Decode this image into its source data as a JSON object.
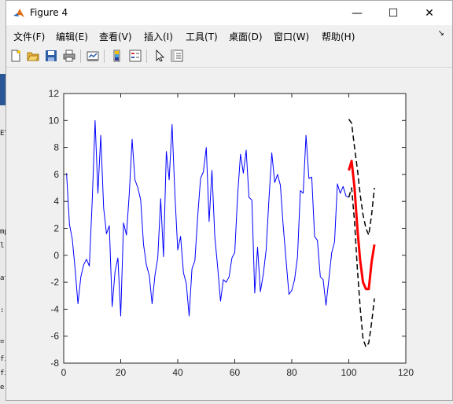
{
  "window": {
    "title": "Figure 4",
    "minimize_symbol": "—",
    "maximize_symbol": "☐",
    "close_symbol": "✕",
    "dock_symbol": "↘"
  },
  "menu": [
    {
      "label": "文件(F)"
    },
    {
      "label": "编辑(E)"
    },
    {
      "label": "查看(V)"
    },
    {
      "label": "插入(I)"
    },
    {
      "label": "工具(T)"
    },
    {
      "label": "桌面(D)"
    },
    {
      "label": "窗口(W)"
    },
    {
      "label": "帮助(H)"
    }
  ],
  "toolbar": {
    "icons": [
      "new-figure-icon",
      "open-file-icon",
      "save-icon",
      "print-icon",
      "link-plot-icon",
      "insert-colorbar-icon",
      "insert-legend-icon",
      "edit-plot-icon",
      "property-inspector-icon"
    ]
  },
  "background": {
    "fragments": [
      "mp",
      "l)",
      "at",
      ":",
      "=",
      "fi",
      "fi",
      "er"
    ],
    "side_fragment": "E\\"
  },
  "chart_data": {
    "type": "line",
    "xlim": [
      0,
      120
    ],
    "ylim": [
      -8,
      12
    ],
    "xticks": [
      0,
      20,
      40,
      60,
      80,
      100,
      120
    ],
    "yticks": [
      -8,
      -6,
      -4,
      -2,
      0,
      2,
      4,
      6,
      8,
      10,
      12
    ],
    "grid": false,
    "series": [
      {
        "style": "solid-blue",
        "color": "#0000ff",
        "x": [
          1,
          2,
          3,
          4,
          5,
          6,
          7,
          8,
          9,
          10,
          11,
          12,
          13,
          14,
          15,
          16,
          17,
          18,
          19,
          20,
          21,
          22,
          23,
          24,
          25,
          26,
          27,
          28,
          29,
          30,
          31,
          32,
          33,
          34,
          35,
          36,
          37,
          38,
          39,
          40,
          41,
          42,
          43,
          44,
          45,
          46,
          47,
          48,
          49,
          50,
          51,
          52,
          53,
          54,
          55,
          56,
          57,
          58,
          59,
          60,
          61,
          62,
          63,
          64,
          65,
          66,
          67,
          68,
          69,
          70,
          71,
          72,
          73,
          74,
          75,
          76,
          77,
          78,
          79,
          80,
          81,
          82,
          83,
          84,
          85,
          86,
          87,
          88,
          89,
          90,
          91,
          92,
          93,
          94,
          95,
          96,
          97,
          98,
          99,
          100
        ],
        "y": [
          6.1,
          2.3,
          1.2,
          -1.0,
          -3.6,
          -1.6,
          -0.7,
          -0.3,
          -0.8,
          4.1,
          10.0,
          4.6,
          8.9,
          3.5,
          1.6,
          2.2,
          -3.8,
          -1.2,
          -0.2,
          -4.5,
          2.4,
          1.5,
          4.6,
          8.6,
          5.6,
          5.0,
          4.1,
          0.8,
          -0.7,
          -1.5,
          -3.6,
          -1.5,
          -0.2,
          4.2,
          -0.1,
          7.7,
          5.6,
          9.7,
          4.5,
          0.4,
          1.4,
          -1.3,
          -2.1,
          -4.5,
          -1.0,
          -0.4,
          2.9,
          5.7,
          6.2,
          8.0,
          2.5,
          6.3,
          1.4,
          -0.9,
          -3.4,
          -1.8,
          -2.0,
          -1.6,
          -0.2,
          0.2,
          4.4,
          7.5,
          6.1,
          7.8,
          4.3,
          4.1,
          -2.8,
          0.6,
          -2.7,
          -1.4,
          0.4,
          4.2,
          7.6,
          5.4,
          6.0,
          5.2,
          2.2,
          -0.4,
          -2.9,
          -2.6,
          -1.8,
          -0.1,
          4.8,
          4.6,
          8.9,
          5.7,
          5.8,
          1.4,
          1.1,
          -1.6,
          -1.8,
          -3.7,
          -1.8,
          0.2,
          1.0,
          5.3,
          4.6,
          5.1,
          4.4,
          4.3
        ]
      },
      {
        "style": "solid-red-thick",
        "color": "#ff0000",
        "x": [
          100,
          101,
          102,
          103,
          104,
          105,
          106,
          107,
          108,
          109
        ],
        "y": [
          6.3,
          7.0,
          5.0,
          2.0,
          -0.4,
          -2.0,
          -2.5,
          -2.5,
          -0.5,
          0.8
        ]
      },
      {
        "style": "dashed-black-upper",
        "color": "#000000",
        "x": [
          100,
          101,
          102,
          103,
          104,
          105,
          106,
          107,
          108,
          109
        ],
        "y": [
          10.1,
          9.8,
          8.0,
          6.4,
          4.5,
          3.0,
          2.0,
          1.5,
          3.0,
          5.0
        ]
      },
      {
        "style": "dashed-black-lower",
        "color": "#000000",
        "x": [
          100,
          101,
          102,
          103,
          104,
          105,
          106,
          107,
          108,
          109
        ],
        "y": [
          4.3,
          5.0,
          2.5,
          -1.0,
          -3.9,
          -6.2,
          -6.8,
          -6.5,
          -5.0,
          -3.2
        ]
      }
    ]
  }
}
